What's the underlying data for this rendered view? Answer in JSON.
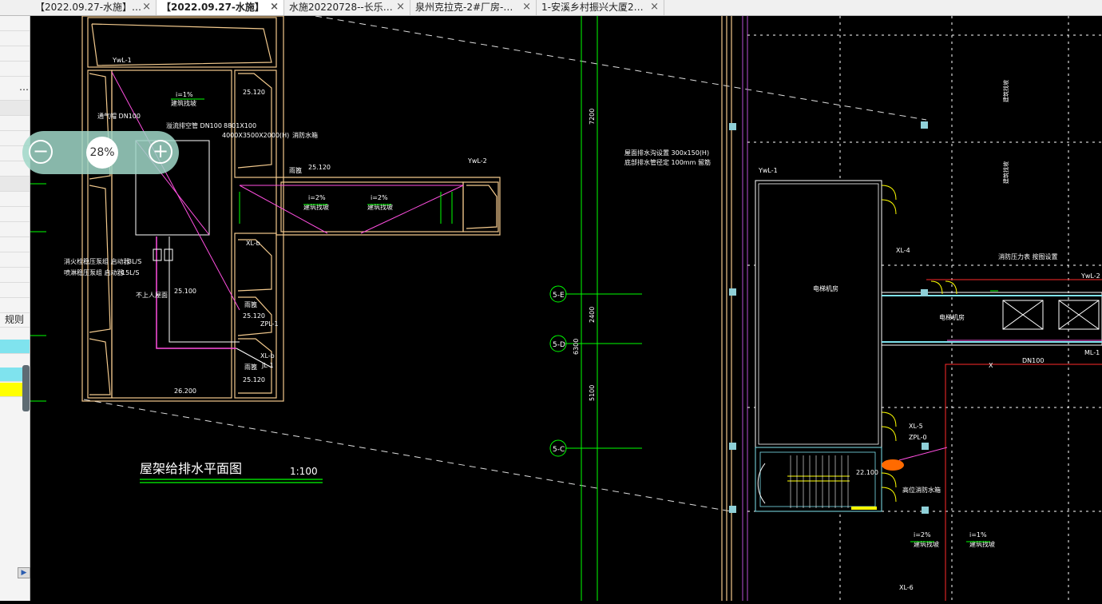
{
  "tabs": [
    {
      "label": "【2022.09.27-水施】…",
      "close": "×",
      "active": false
    },
    {
      "label": "【2022.09.27-水施】",
      "close": "×",
      "active": true
    },
    {
      "label": "水施20220728--长乐…",
      "close": "×",
      "active": false
    },
    {
      "label": "泉州克拉克-2#厂房-…",
      "close": "×",
      "active": false
    },
    {
      "label": "1-安溪乡村振兴大厦2…",
      "close": "×",
      "active": false
    }
  ],
  "left_panel": {
    "more": "…",
    "rules_label": "规则",
    "colors": {
      "cyan": "#7fe3ee",
      "yellow": "#ffff00"
    }
  },
  "zoom": {
    "minus": "⊖",
    "value": "28%",
    "plus": "⊕"
  },
  "drawing": {
    "title": "屋架给排水平面图",
    "scale": "1:100",
    "labels": {
      "ywl1": "YwL-1",
      "ywl2": "YwL-2",
      "slope1": "i=1%",
      "slope2": "i=2%",
      "slope_note": "建筑找坡",
      "elev_25120": "25.120",
      "elev_25100": "25.100",
      "elev_26200": "26.200",
      "elev_22100": "22.100",
      "vent": "通气帽 DN100",
      "overflow": "溢流排空管 DN100",
      "fire_tank": "消防水箱",
      "tank_size": "4000X3500X2000(H)",
      "tank_dim": "8801X100",
      "rain": "雨篦",
      "xl_b": "XL-b",
      "zpl1": "ZPL-1",
      "jl1": "JL-1",
      "no_roof": "不上人屋面",
      "flow1": "3L/S",
      "flow2": "15L/S",
      "pump_note1": "消火栓稳压泵组 启动器",
      "pump_note2": "喷淋稳压泵组 启动器",
      "axis_5e": "5-E",
      "axis_5d": "5-D",
      "axis_5c": "5-C",
      "dim_7200": "7200",
      "dim_2400": "2400",
      "dim_5100": "5100",
      "dim_6300": "6300",
      "gutter": "屋面排水沟设置 300x150(H)",
      "gutter2": "底部排水管径定 100mm 留筋",
      "room_unused": "电梯机房",
      "room_machine": "电梯机房",
      "xl4": "XL-4",
      "xl5": "XL-5",
      "xl6": "XL-6",
      "zpl0": "ZPL-0",
      "ml1": "ML-1",
      "dn100": "DN100",
      "x_mark": "X",
      "elev_right": "25.100",
      "valve": "消防阀门",
      "pressure": "消防压力表 按图设置",
      "backup": "高位消防水箱"
    }
  }
}
